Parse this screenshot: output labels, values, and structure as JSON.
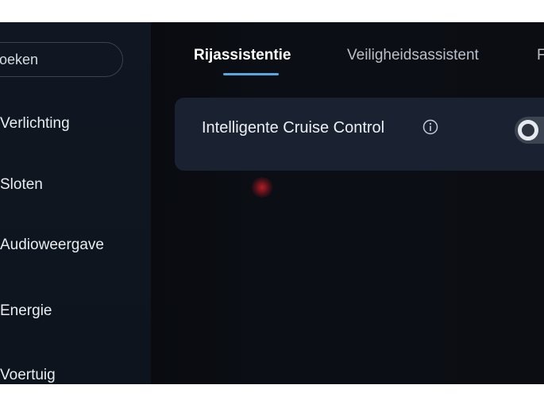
{
  "sidebar": {
    "search_text": "oeken",
    "items": [
      {
        "label": "Verlichting"
      },
      {
        "label": "Sloten"
      },
      {
        "label": "Audioweergave"
      },
      {
        "label": "Energie"
      },
      {
        "label": "Voertuig"
      }
    ]
  },
  "tabs": [
    {
      "label": "Rijassistentie",
      "active": true
    },
    {
      "label": "Veiligheidsassistent",
      "active": false
    },
    {
      "label": "F",
      "active": false
    }
  ],
  "settings": [
    {
      "label": "Intelligente Cruise Control",
      "icon": "info-icon",
      "toggle_on": false
    }
  ],
  "colors": {
    "accent": "#5aa6e0",
    "background": "#0b0e14",
    "card": "#1a2231"
  }
}
